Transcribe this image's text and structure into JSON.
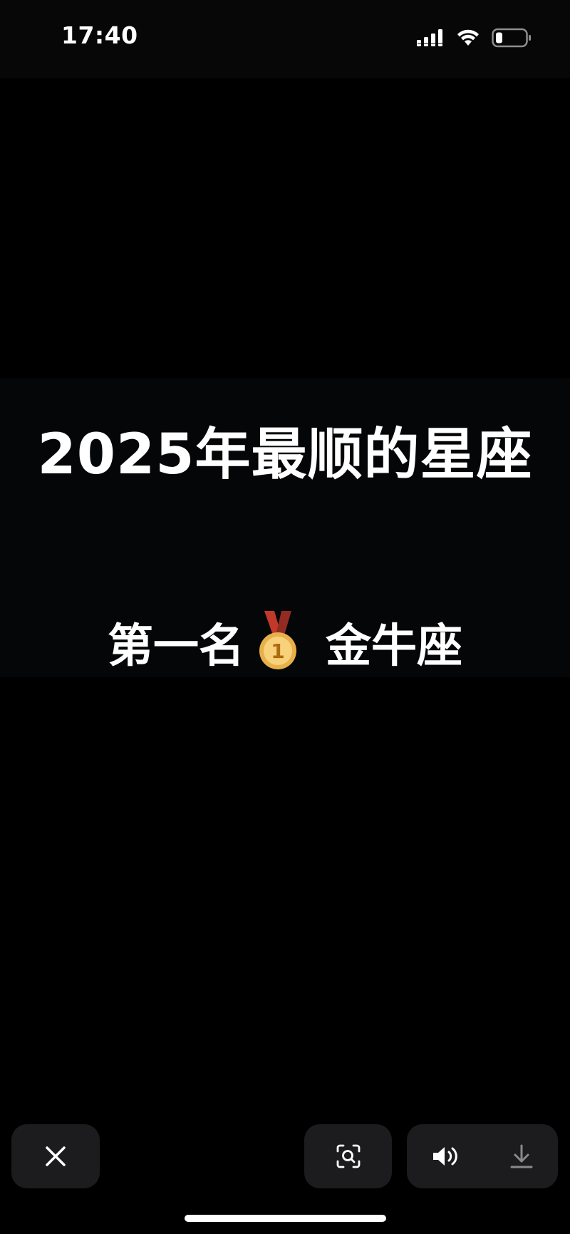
{
  "status_bar": {
    "time": "17:40",
    "icons": [
      "cellular-signal-icon",
      "wifi-icon",
      "battery-icon"
    ]
  },
  "content": {
    "headline": "2025年最顺的星座",
    "rank_label": "第一名",
    "rank_icon": "first-place-medal-icon",
    "sign_name": "金牛座"
  },
  "controls": {
    "icons": [
      "close-icon",
      "visual-search-icon",
      "volume-icon",
      "download-icon"
    ]
  },
  "colors": {
    "background": "#000000",
    "text": "#ffffff",
    "control_bg": "#1c1c1e"
  }
}
